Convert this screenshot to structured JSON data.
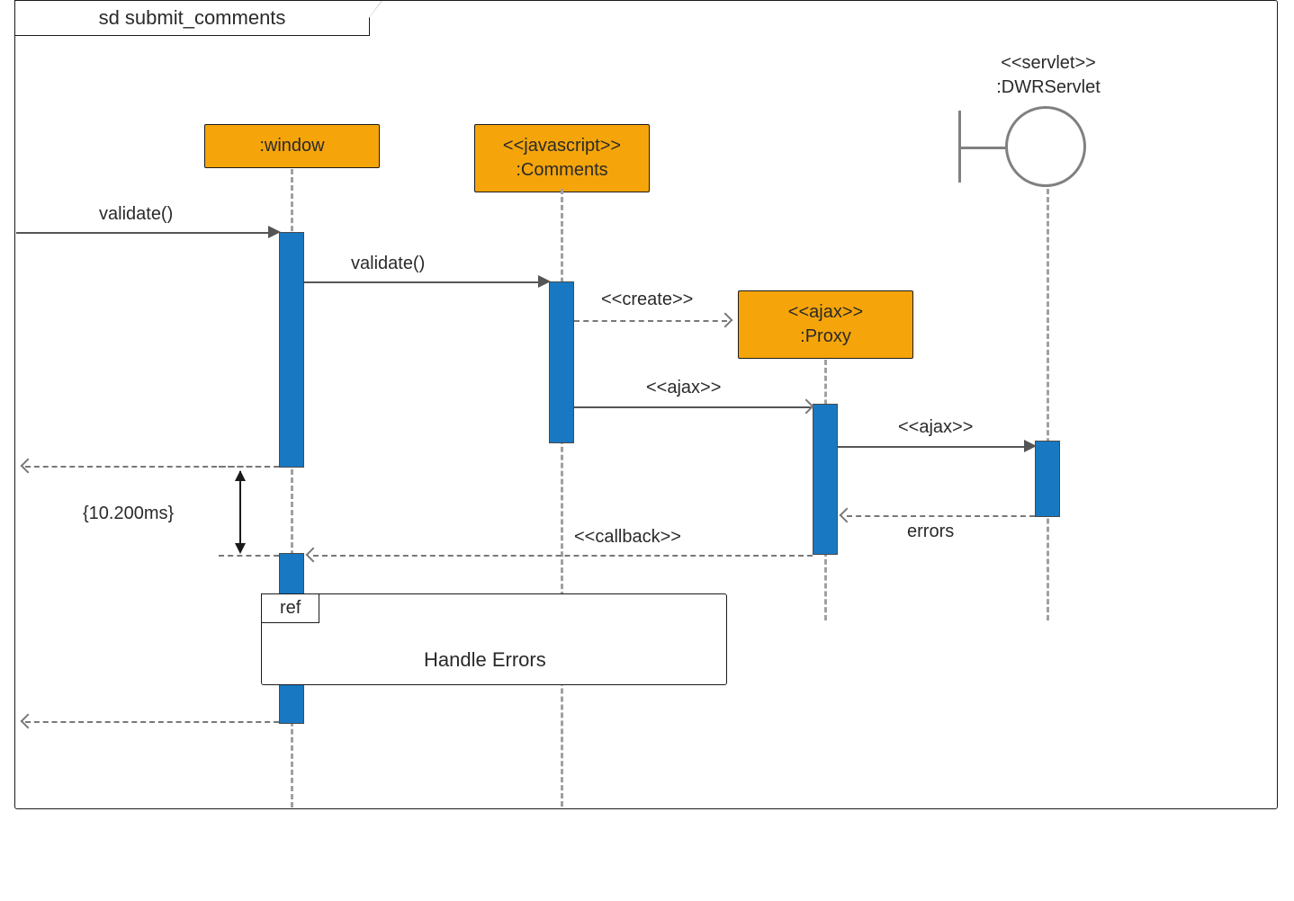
{
  "frame": {
    "title": "sd submit_comments"
  },
  "boundary": {
    "stereotype": "<<servlet>>",
    "name": ":DWRServlet"
  },
  "lifelines": {
    "window": {
      "label": ":window"
    },
    "comments": {
      "stereotype": "<<javascript>>",
      "name": ":Comments"
    },
    "proxy": {
      "stereotype": "<<ajax>>",
      "name": ":Proxy"
    }
  },
  "messages": {
    "validate_into_window": "validate()",
    "validate_to_comments": "validate()",
    "create_proxy": "<<create>>",
    "ajax_to_proxy": "<<ajax>>",
    "ajax_to_servlet": "<<ajax>>",
    "errors_return": "errors",
    "callback_return": "<<callback>>"
  },
  "duration": {
    "label": "{10.200ms}"
  },
  "ref": {
    "tag": "ref",
    "text": "Handle Errors"
  }
}
